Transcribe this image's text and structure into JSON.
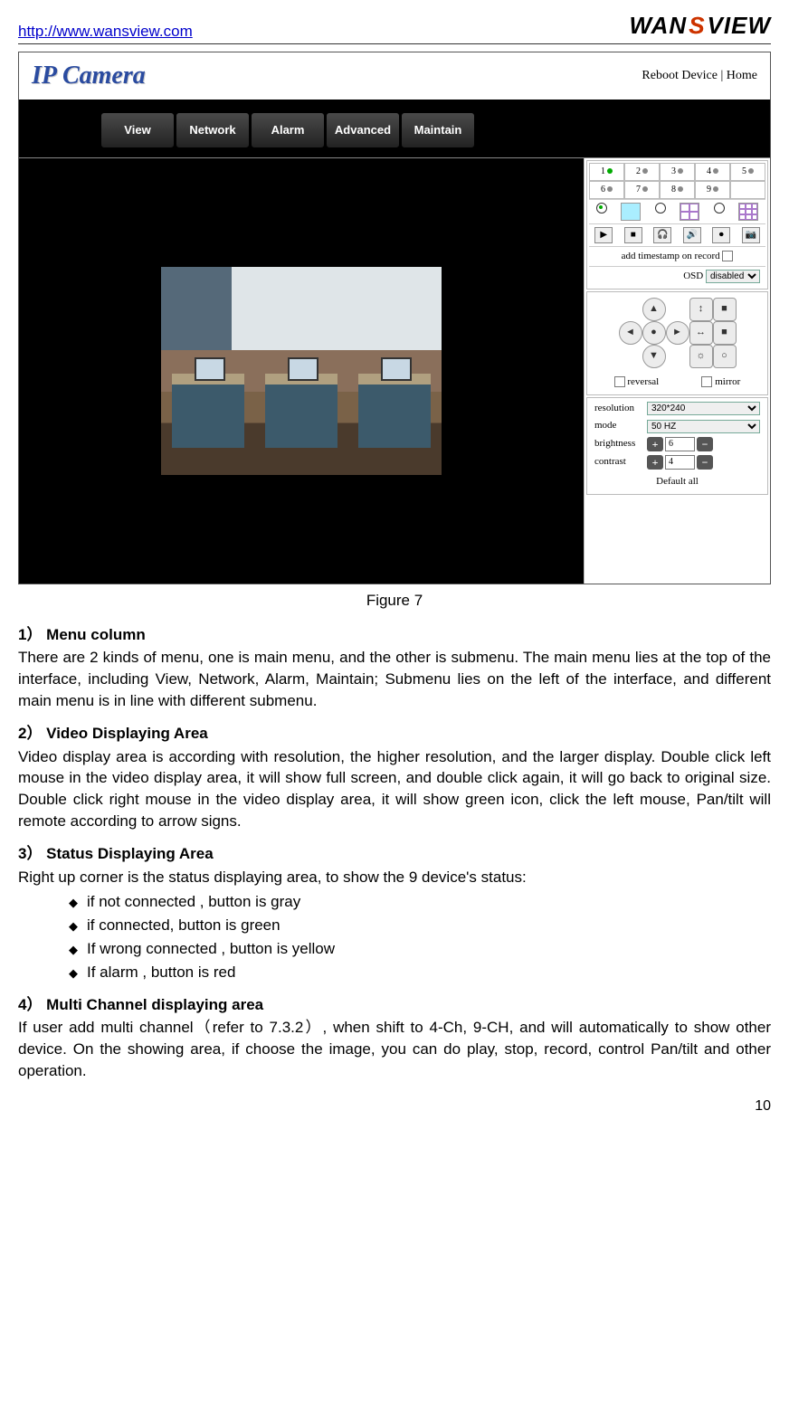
{
  "header": {
    "url": "http://www.wansview.com",
    "logo_wan": "WAN",
    "logo_s": "S",
    "logo_view": "VIEW"
  },
  "app": {
    "logo": "IP Camera",
    "top_links": "Reboot Device | Home",
    "menu": [
      "View",
      "Network",
      "Alarm",
      "Advanced",
      "Maintain"
    ],
    "channels": [
      "1",
      "2",
      "3",
      "4",
      "5",
      "6",
      "7",
      "8",
      "9"
    ],
    "ts_label": "add timestamp on record",
    "osd_label": "OSD",
    "osd_value": "disabled",
    "reversal": "reversal",
    "mirror": "mirror",
    "res_label": "resolution",
    "res_value": "320*240",
    "mode_label": "mode",
    "mode_value": "50 HZ",
    "bright_label": "brightness",
    "bright_value": "6",
    "contrast_label": "contrast",
    "contrast_value": "4",
    "default_all": "Default all"
  },
  "caption": "Figure 7",
  "s1": {
    "h": "1） Menu column",
    "p": "There are 2 kinds of menu, one is main menu, and the other is submenu. The main menu lies at the top of the interface, including View, Network, Alarm, Maintain; Submenu lies on the left of the interface, and different main menu is in line with different submenu."
  },
  "s2": {
    "h": "2） Video Displaying Area",
    "p": "Video display area is according with resolution, the higher resolution, and the larger display. Double click left mouse in the video display area, it will show full screen, and double click again, it will go back to original size. Double click right mouse in the video display area, it will show green icon, click the left mouse, Pan/tilt will remote according to arrow signs."
  },
  "s3": {
    "h": "3） Status Displaying Area",
    "p": "Right up corner is the status displaying area, to show the 9 device's status:",
    "b1": "if not connected , button is gray",
    "b2": "if connected, button is green",
    "b3": "If wrong connected , button is yellow",
    "b4": "If alarm , button is red"
  },
  "s4": {
    "h": "4） Multi Channel displaying area",
    "p": "If user add multi channel（refer to 7.3.2）, when shift to 4-Ch, 9-CH, and will automatically to show other device. On the showing area, if choose the image, you can do play, stop, record, control Pan/tilt and other operation."
  },
  "page_num": "10"
}
